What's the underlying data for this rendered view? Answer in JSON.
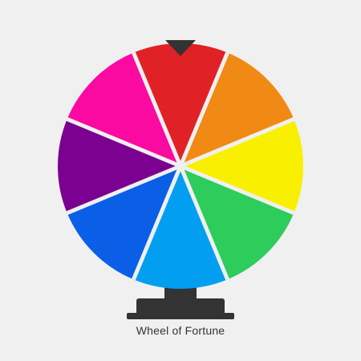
{
  "title": "Wheel of Fortune",
  "wheel": {
    "segment_colors": [
      "#e02226",
      "#f08a14",
      "#f8f000",
      "#2ecc5a",
      "#029ff0",
      "#0a5fe6",
      "#7b0190",
      "#fa0aa0"
    ],
    "divider_color": "#f0f0f0",
    "pointer_color": "#333333",
    "stand_color": "#333333"
  }
}
